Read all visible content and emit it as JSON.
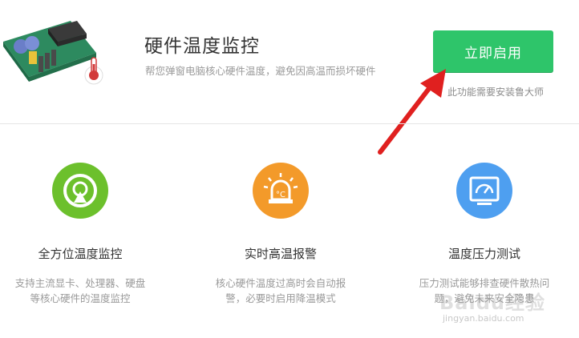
{
  "header": {
    "title": "硬件温度监控",
    "subtitle": "帮您弹窗电脑核心硬件温度，避免因高温而损坏硬件",
    "enable_button_label": "立即启用",
    "install_note": "此功能需要安装鲁大师"
  },
  "features": [
    {
      "icon": "target-icon",
      "color": "#6cc02c",
      "title": "全方位温度监控",
      "desc_line1": "支持主流显卡、处理器、硬盘",
      "desc_line2": "等核心硬件的温度监控"
    },
    {
      "icon": "alarm-icon",
      "color": "#f39a2a",
      "title": "实时高温报警",
      "desc_line1": "核心硬件温度过高时会自动报",
      "desc_line2": "警，必要时启用降温模式"
    },
    {
      "icon": "gauge-monitor-icon",
      "color": "#4e9ff0",
      "title": "温度压力测试",
      "desc_line1": "压力测试能够排查硬件散热问",
      "desc_line2": "题，避免未来安全隐患"
    }
  ],
  "watermark": {
    "main": "Baidu经验",
    "sub": "jingyan.baidu.com"
  },
  "colors": {
    "accent_green": "#2ec56a",
    "arrow_red": "#e0201f"
  }
}
